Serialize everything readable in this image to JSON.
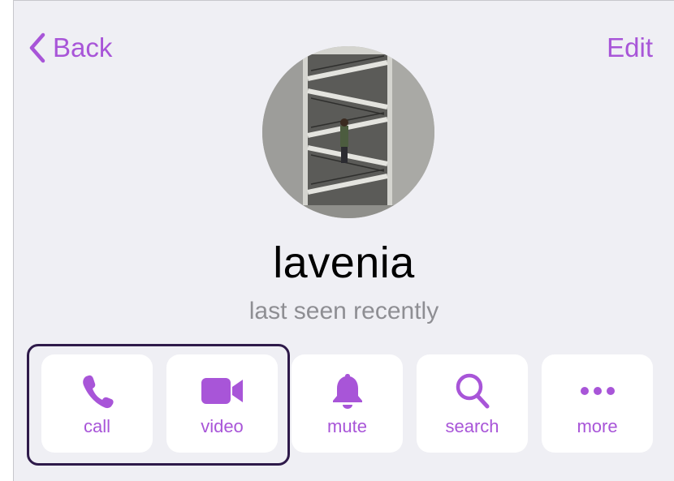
{
  "nav": {
    "back_label": "Back",
    "edit_label": "Edit"
  },
  "profile": {
    "name": "lavenia",
    "status": "last seen recently"
  },
  "actions": [
    {
      "label": "call",
      "icon": "phone-icon"
    },
    {
      "label": "video",
      "icon": "video-camera-icon"
    },
    {
      "label": "mute",
      "icon": "bell-icon"
    },
    {
      "label": "search",
      "icon": "magnifier-icon"
    },
    {
      "label": "more",
      "icon": "ellipsis-icon"
    }
  ],
  "colors": {
    "accent": "#a855d8",
    "background": "#efeff4",
    "secondary_text": "#8e8e93",
    "highlight_border": "#2e1a4a"
  }
}
